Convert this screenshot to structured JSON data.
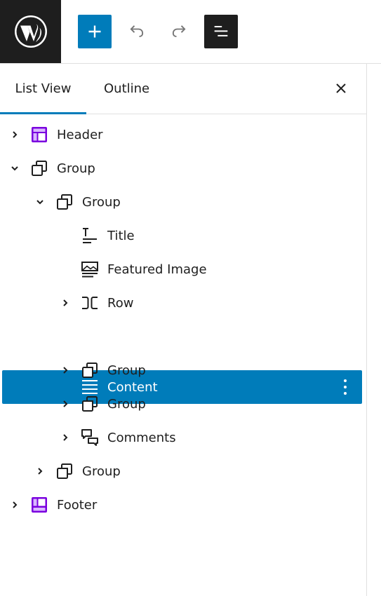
{
  "colors": {
    "accent": "#007cba",
    "dark": "#1e1e1e",
    "purple": "#7a00df",
    "border": "#e0e0e0"
  },
  "toolbar": {
    "logo_icon": "wordpress-logo-icon",
    "add_icon": "plus-icon",
    "undo_icon": "undo-icon",
    "redo_icon": "redo-icon",
    "listview_icon": "list-view-icon"
  },
  "tabs": [
    {
      "label": "List View",
      "active": true
    },
    {
      "label": "Outline",
      "active": false
    }
  ],
  "close_icon": "close-icon",
  "tree": [
    {
      "label": "Header",
      "icon": "template-part-header-icon",
      "expanded": false,
      "has_children": true,
      "depth": 0
    },
    {
      "label": "Group",
      "icon": "group-icon",
      "expanded": true,
      "has_children": true,
      "depth": 0
    },
    {
      "label": "Group",
      "icon": "group-icon",
      "expanded": true,
      "has_children": true,
      "depth": 1
    },
    {
      "label": "Title",
      "icon": "post-title-icon",
      "has_children": false,
      "depth": 2
    },
    {
      "label": "Featured Image",
      "icon": "featured-image-icon",
      "has_children": false,
      "depth": 2
    },
    {
      "label": "Row",
      "icon": "row-icon",
      "expanded": false,
      "has_children": true,
      "depth": 2
    },
    {
      "label": "Content",
      "icon": "post-content-icon",
      "has_children": false,
      "depth": 2,
      "selected": true,
      "options_icon": "more-vertical-icon"
    },
    {
      "label": "Group",
      "icon": "group-icon",
      "expanded": false,
      "has_children": true,
      "depth": 2
    },
    {
      "label": "Group",
      "icon": "group-icon",
      "expanded": false,
      "has_children": true,
      "depth": 2
    },
    {
      "label": "Comments",
      "icon": "comments-icon",
      "expanded": false,
      "has_children": true,
      "depth": 2
    },
    {
      "label": "Group",
      "icon": "group-icon",
      "expanded": false,
      "has_children": true,
      "depth": 1
    },
    {
      "label": "Footer",
      "icon": "template-part-footer-icon",
      "expanded": false,
      "has_children": true,
      "depth": 0
    }
  ]
}
